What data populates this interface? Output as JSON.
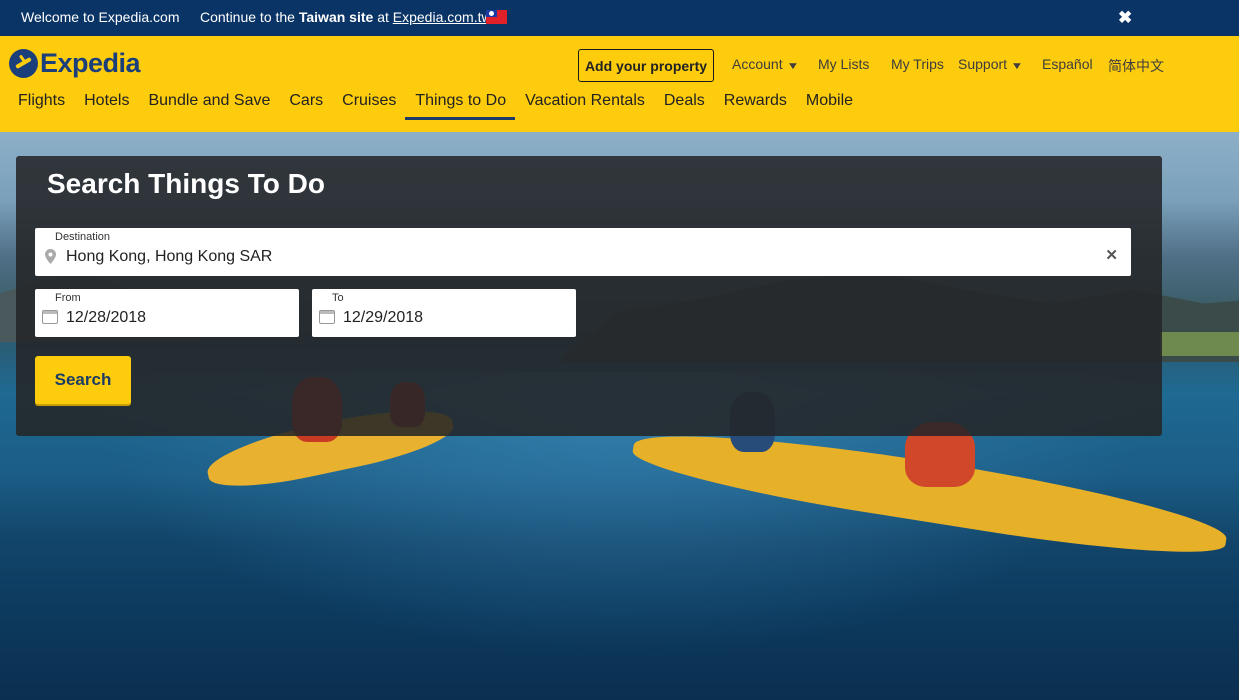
{
  "topbar": {
    "welcome": "Welcome to Expedia.com",
    "continue_prefix": "Continue to the",
    "continue_bold": "Taiwan site",
    "continue_mid": "at",
    "continue_link": "Expedia.com.tw",
    "flag_icon": "taiwan-flag-icon",
    "close_label": "✖"
  },
  "header": {
    "logo": "Expedia",
    "add_property": "Add your property",
    "utility": [
      {
        "label": "Account",
        "dropdown": true
      },
      {
        "label": "My Lists",
        "dropdown": false
      },
      {
        "label": "My Trips",
        "dropdown": false
      },
      {
        "label": "Support",
        "dropdown": true
      },
      {
        "label": "Español",
        "dropdown": false
      },
      {
        "label": "简体中文",
        "dropdown": false
      }
    ],
    "nav": [
      {
        "label": "Flights",
        "active": false
      },
      {
        "label": "Hotels",
        "active": false
      },
      {
        "label": "Bundle and Save",
        "active": false
      },
      {
        "label": "Cars",
        "active": false
      },
      {
        "label": "Cruises",
        "active": false
      },
      {
        "label": "Things to Do",
        "active": true
      },
      {
        "label": "Vacation Rentals",
        "active": false
      },
      {
        "label": "Deals",
        "active": false
      },
      {
        "label": "Rewards",
        "active": false
      },
      {
        "label": "Mobile",
        "active": false
      }
    ]
  },
  "search": {
    "title": "Search Things To Do",
    "destination_label": "Destination",
    "destination_value": "Hong Kong, Hong Kong SAR",
    "from_label": "From",
    "from_value": "12/28/2018",
    "to_label": "To",
    "to_value": "12/29/2018",
    "button": "Search"
  },
  "colors": {
    "topbar_bg": "#0b3466",
    "brand_yellow": "#fdcc0d",
    "brand_navy": "#1b3f7a"
  }
}
